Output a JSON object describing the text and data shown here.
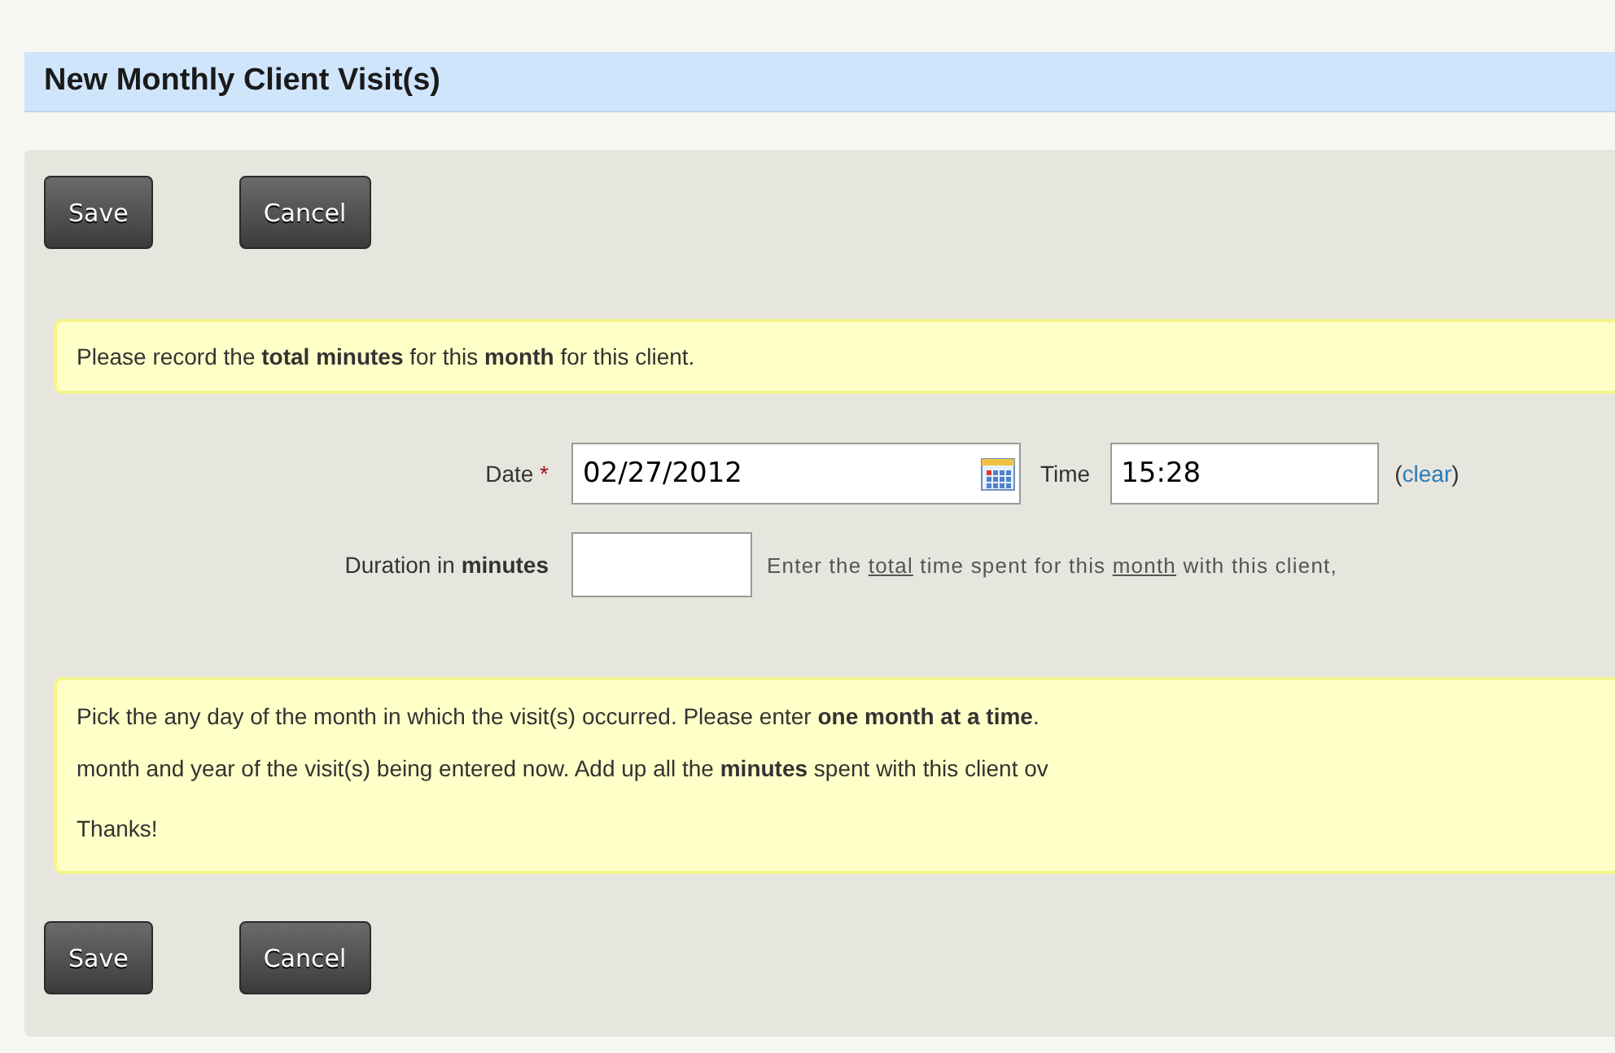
{
  "title": "New Monthly Client Visit(s)",
  "top_buttons": [
    {
      "label": "Save"
    },
    {
      "label": "Cancel"
    }
  ],
  "intro_note": "Please record the **total minutes** for this **month** for this client.",
  "date": {
    "label": "Date",
    "required_mark": "*",
    "value": "02/27/2012"
  },
  "time": {
    "label": "Time",
    "value": "15:28",
    "clear_link": "clear",
    "clear_open": "(",
    "clear_close": ")"
  },
  "duration": {
    "label": "Duration in **minutes**",
    "hint": [
      {
        "text": "Enter the ",
        "underline": false
      },
      {
        "text": "total",
        "underline": true
      },
      {
        "text": " time spent for this ",
        "underline": false
      },
      {
        "text": "month",
        "underline": true
      },
      {
        "text": " with this client,",
        "underline": false
      }
    ]
  },
  "info_note_lines": [
    "Pick the any day of the month in which the visit(s) occurred. Please enter **one month at a time**.",
    "month and year of the visit(s) being entered now. Add up all the **minutes** spent with this client ov",
    "Thanks!"
  ],
  "bottom_buttons": [
    {
      "label": "Save"
    },
    {
      "label": "Cancel"
    }
  ]
}
